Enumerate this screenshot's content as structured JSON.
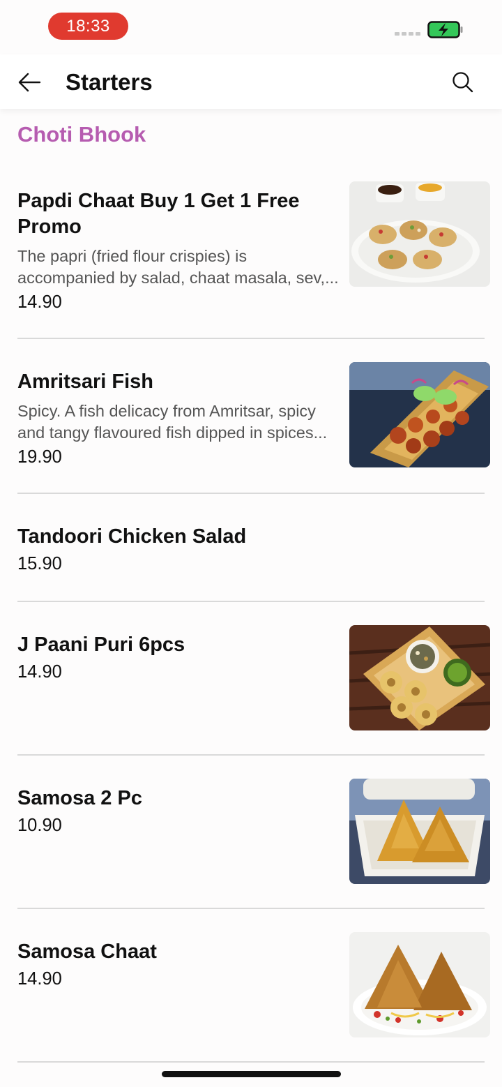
{
  "status_bar": {
    "time": "18:33"
  },
  "header": {
    "title": "Starters"
  },
  "section": {
    "title": "Choti Bhook"
  },
  "items": [
    {
      "name": "Papdi Chaat Buy 1 Get 1 Free Promo",
      "description": "The papri (fried flour crispies) is accompanied by salad, chaat masala, sev,...",
      "price": "14.90"
    },
    {
      "name": "Amritsari Fish",
      "description": "Spicy. A fish delicacy from Amritsar, spicy and tangy flavoured fish dipped in spices...",
      "price": "19.90"
    },
    {
      "name": "Tandoori Chicken Salad",
      "price": "15.90"
    },
    {
      "name": "J Paani Puri 6pcs",
      "price": "14.90"
    },
    {
      "name": "Samosa 2 Pc",
      "price": "10.90"
    },
    {
      "name": "Samosa Chaat",
      "price": "14.90"
    }
  ]
}
